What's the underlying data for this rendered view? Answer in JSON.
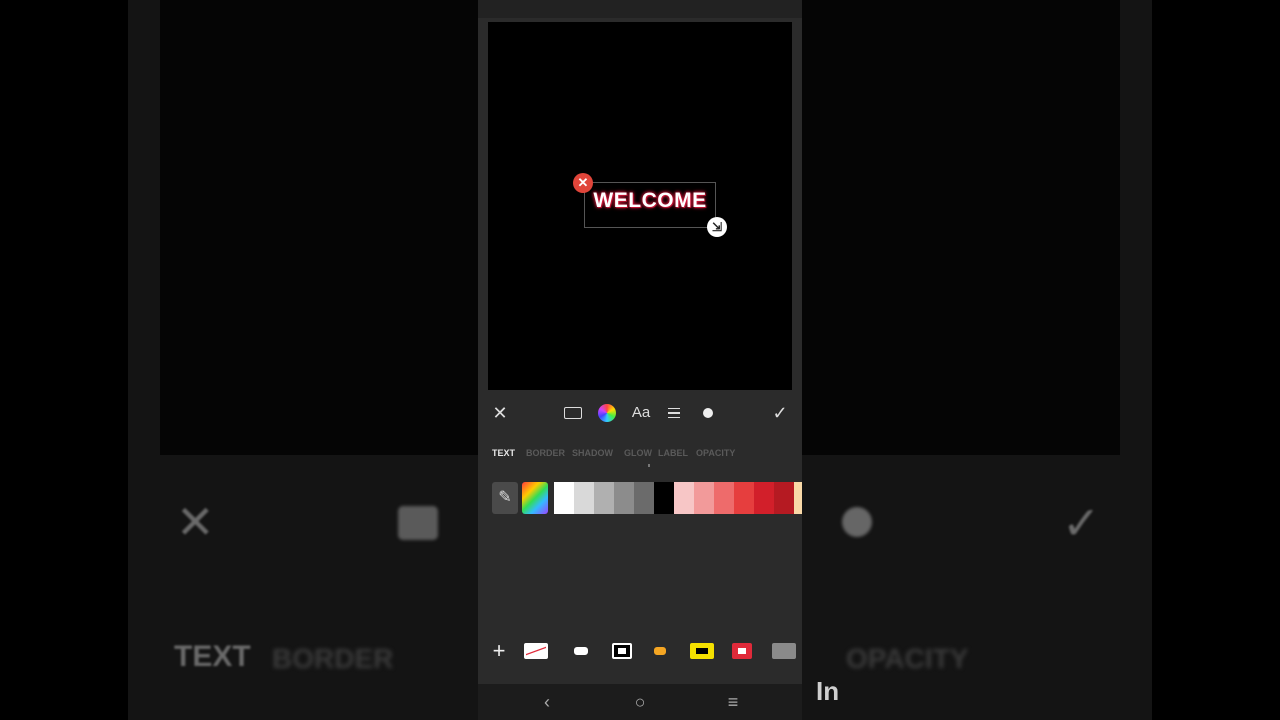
{
  "canvas": {
    "text": "WELCOME",
    "delete_glyph": "✕",
    "resize_glyph": "⇲"
  },
  "toolbar": {
    "close_glyph": "✕",
    "font_label": "Aa",
    "confirm_glyph": "✓"
  },
  "tabs": [
    {
      "label": "TEXT",
      "active": true
    },
    {
      "label": "BORDER",
      "active": false
    },
    {
      "label": "SHADOW",
      "active": false
    },
    {
      "label": "GLOW",
      "active": false
    },
    {
      "label": "LABEL",
      "active": false
    },
    {
      "label": "OPACITY",
      "active": false
    }
  ],
  "palette": {
    "picker_glyph": "✎",
    "colors": [
      "#ffffff",
      "#d9d9d9",
      "#b0b0b0",
      "#8c8c8c",
      "#6b6b6b",
      "#000000",
      "#f7c6c6",
      "#f29a9a",
      "#ee6b6b",
      "#e63e3e",
      "#d21f2a",
      "#b51a22",
      "#f9d9a8",
      "#f8c98a",
      "#f6b860"
    ]
  },
  "label_styles": {
    "add_glyph": "+",
    "chips": [
      {
        "name": "none",
        "bg": "#ffffff",
        "border": "#ffffff"
      },
      {
        "name": "white-round",
        "bg": "#ffffff",
        "border": "#ffffff"
      },
      {
        "name": "black-white",
        "bg": "#000000",
        "border": "#ffffff"
      },
      {
        "name": "orange",
        "bg": "#f5a623",
        "border": "#f5a623"
      },
      {
        "name": "yellow-black",
        "bg": "#f5e000",
        "border": "#f5e000"
      },
      {
        "name": "red-white",
        "bg": "#e02a3a",
        "border": "#e02a3a"
      },
      {
        "name": "gray",
        "bg": "#8a8a8a",
        "border": "#8a8a8a"
      }
    ]
  },
  "nav": {
    "back_glyph": "‹",
    "home_glyph": "○",
    "recents_glyph": "≡"
  },
  "background": {
    "text": "TEXT",
    "watermark": "In"
  }
}
